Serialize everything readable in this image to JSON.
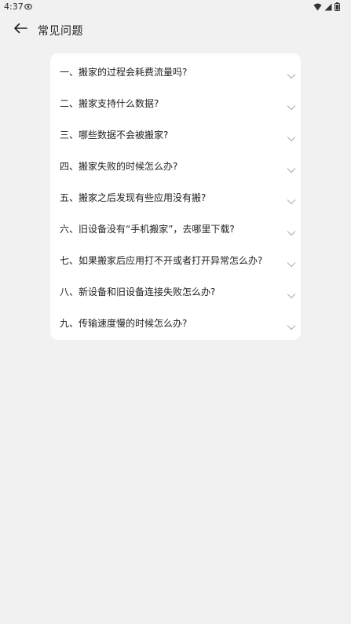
{
  "status_bar": {
    "time": "4:37"
  },
  "header": {
    "title": "常见问题"
  },
  "faq": {
    "items": [
      {
        "label": "一、搬家的过程会耗费流量吗?"
      },
      {
        "label": "二、搬家支持什么数据?"
      },
      {
        "label": "三、哪些数据不会被搬家?"
      },
      {
        "label": "四、搬家失败的时候怎么办?"
      },
      {
        "label": "五、搬家之后发现有些应用没有搬?"
      },
      {
        "label": "六、旧设备没有“手机搬家”，去哪里下载?"
      },
      {
        "label": "七、如果搬家后应用打不开或者打开异常怎么办?"
      },
      {
        "label": "八、新设备和旧设备连接失败怎么办?"
      },
      {
        "label": "九、传输速度慢的时候怎么办?"
      }
    ]
  },
  "icons": {
    "back": "arrow-left-icon",
    "chevron": "chevron-down-icon",
    "wifi": "wifi-icon",
    "signal": "signal-icon",
    "battery": "battery-icon",
    "eye": "eye-icon"
  },
  "colors": {
    "background": "#f1f1f1",
    "card": "#ffffff",
    "chevron": "#b3b3b3"
  }
}
